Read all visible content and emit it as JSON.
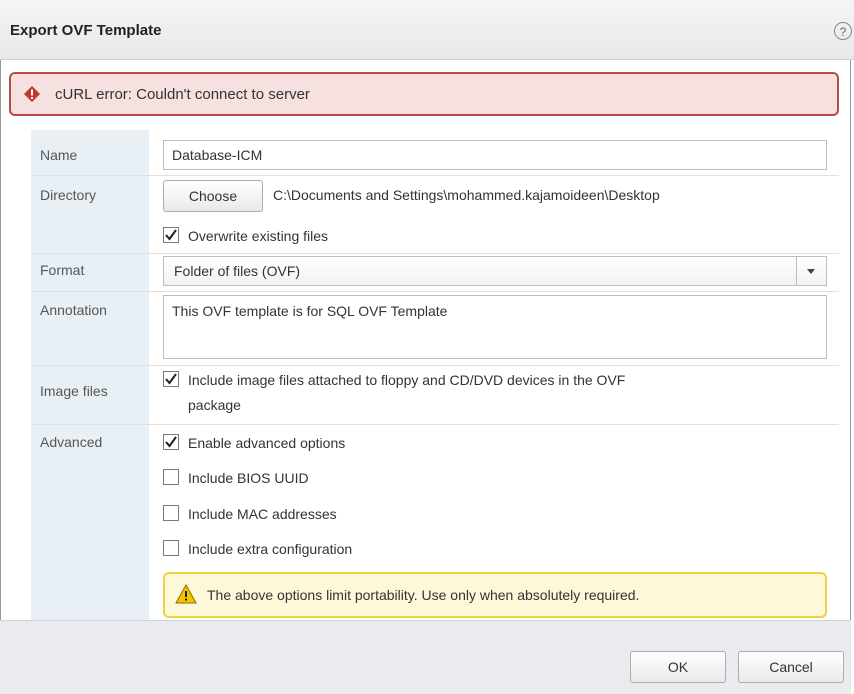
{
  "dialog": {
    "title": "Export OVF Template",
    "help_label": "?"
  },
  "error": {
    "icon": "error-diamond-icon",
    "text": "cURL error: Couldn't connect to server",
    "color": "#b84a4a"
  },
  "form": {
    "name_label": "Name",
    "name_value": "Database-ICM",
    "directory_label": "Directory",
    "choose_button": "Choose",
    "directory_path": "C:\\Documents and Settings\\mohammed.kajamoideen\\Desktop",
    "overwrite_label": "Overwrite existing files",
    "overwrite_checked": true,
    "format_label": "Format",
    "format_value": "Folder of files (OVF)",
    "annotation_label": "Annotation",
    "annotation_value": "This OVF template is for SQL OVF Template",
    "image_files_label": "Image files",
    "image_files_option_line1": "Include image files attached to floppy and CD/DVD devices in the OVF",
    "image_files_option_line2": "package",
    "image_files_checked": true,
    "advanced_label": "Advanced",
    "advanced_options": [
      {
        "label": "Enable advanced options",
        "checked": true
      },
      {
        "label": "Include BIOS UUID",
        "checked": false
      },
      {
        "label": "Include MAC addresses",
        "checked": false
      },
      {
        "label": "Include extra configuration",
        "checked": false
      }
    ],
    "warning_icon": "warning-triangle-icon",
    "warning_text": "The above options limit portability. Use only when absolutely required."
  },
  "footer": {
    "ok_button": "OK",
    "cancel_button": "Cancel"
  }
}
